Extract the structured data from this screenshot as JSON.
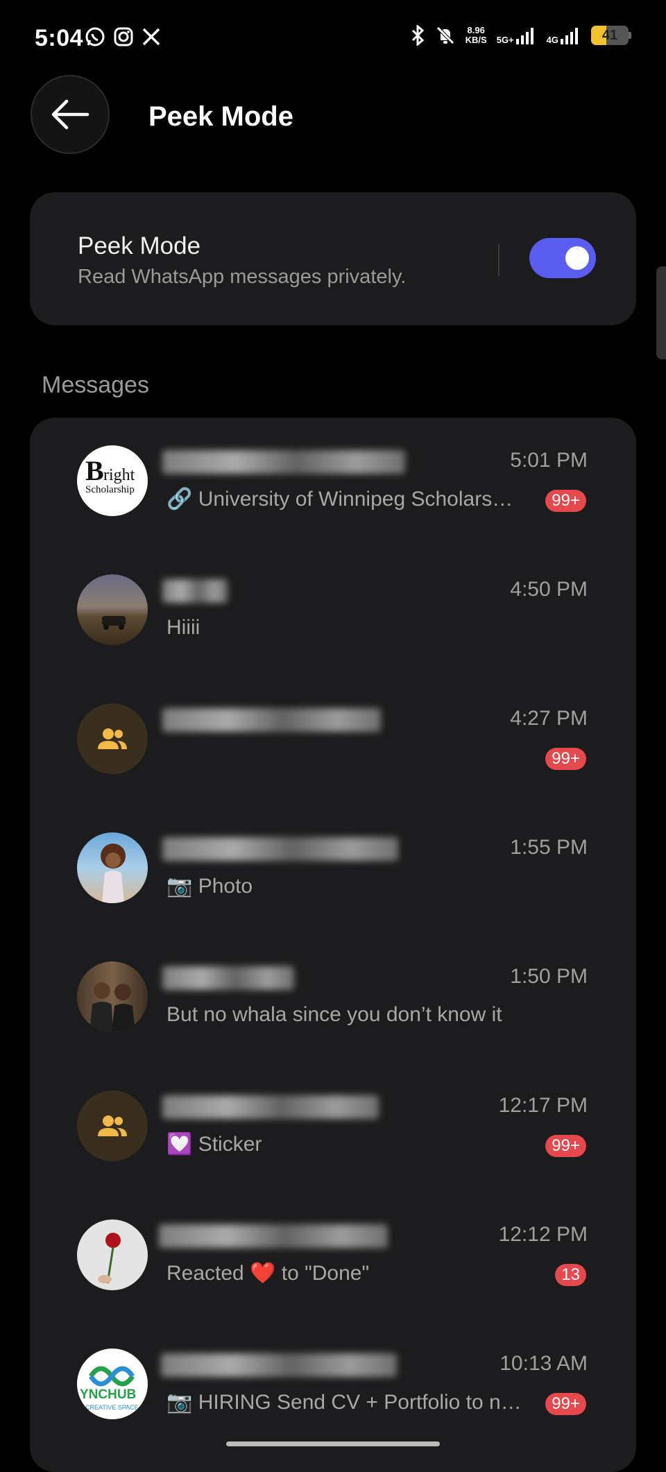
{
  "status_bar": {
    "time": "5:04",
    "left_icons": [
      "whatsapp-icon",
      "instagram-icon",
      "x-icon"
    ],
    "speed_top": "8.96",
    "speed_bottom": "KB/S",
    "net_5g": "5G+",
    "net_4g": "4G",
    "battery": "41",
    "battery_level": 0.41,
    "battery_color": "#f2c12e"
  },
  "header": {
    "title": "Peek Mode"
  },
  "peek_card": {
    "title": "Peek Mode",
    "subtitle": "Read WhatsApp messages privately.",
    "toggle_on": true,
    "toggle_color": "#5b5cf0"
  },
  "messages_section": {
    "label": "Messages",
    "items": [
      {
        "time": "5:01 PM",
        "preview": "🔗 University of Winnipeg Scholars…",
        "badge": "99+",
        "avatar": "bright-scholarship-logo"
      },
      {
        "time": "4:50 PM",
        "preview": "Hiiii",
        "badge": "",
        "avatar": "landscape-photo"
      },
      {
        "time": "4:27 PM",
        "preview": "",
        "badge": "99+",
        "avatar": "group-icon"
      },
      {
        "time": "1:55 PM",
        "preview": "📷 Photo",
        "badge": "",
        "avatar": "anime-girl-photo"
      },
      {
        "time": "1:50 PM",
        "preview": "But no whala since you don’t know it",
        "badge": "",
        "avatar": "couple-photo"
      },
      {
        "time": "12:17 PM",
        "preview": "💟 Sticker",
        "badge": "99+",
        "avatar": "group-icon"
      },
      {
        "time": "12:12 PM",
        "preview": "Reacted ❤️ to \"Done\"",
        "badge": "13",
        "avatar": "rose-photo"
      },
      {
        "time": "10:13 AM",
        "preview": "📷 HIRING Send CV + Portfolio to n…",
        "badge": "99+",
        "avatar": "synchub-logo"
      }
    ]
  },
  "colors": {
    "badge": "#e5484d",
    "card": "#1c1c1e",
    "accent": "#5b5cf0"
  }
}
